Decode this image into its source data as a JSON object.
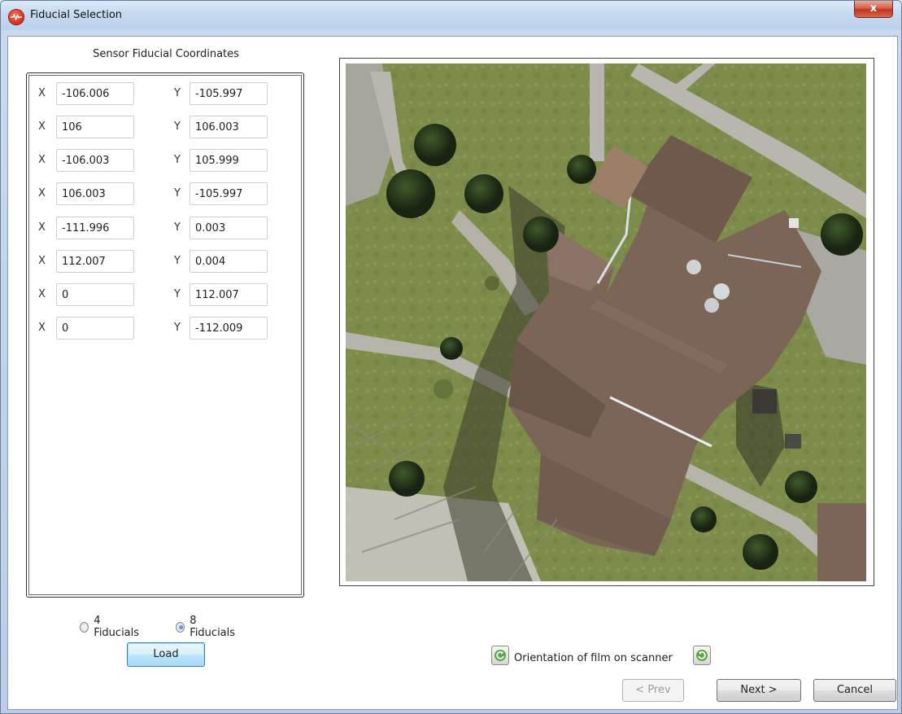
{
  "window": {
    "title": "Fiducial Selection",
    "close_glyph": "x"
  },
  "coordinates": {
    "title": "Sensor Fiducial Coordinates",
    "x_label": "X",
    "y_label": "Y",
    "rows": [
      {
        "x": "-106.006",
        "y": "-105.997"
      },
      {
        "x": "106",
        "y": "106.003"
      },
      {
        "x": "-106.003",
        "y": "105.999"
      },
      {
        "x": "106.003",
        "y": "-105.997"
      },
      {
        "x": "-111.996",
        "y": "0.003"
      },
      {
        "x": "112.007",
        "y": "0.004"
      },
      {
        "x": "0",
        "y": "112.007"
      },
      {
        "x": "0",
        "y": "-112.009"
      }
    ]
  },
  "fiducial_options": {
    "option_4": "4 Fiducials",
    "option_8": "8 Fiducials",
    "selected": "8 Fiducials"
  },
  "buttons": {
    "load": "Load",
    "prev": "< Prev",
    "next": "Next >",
    "cancel": "Cancel"
  },
  "orientation": {
    "label": "Orientation of film on scanner",
    "rotate_left_icon": "rotate-counterclockwise-icon",
    "rotate_right_icon": "rotate-clockwise-icon"
  },
  "colors": {
    "title_bar": "#c6d8ef",
    "close_button": "#c2321b",
    "roof": "#7b6557",
    "grass": "#7f8d4c",
    "button_focus": "#3c7fb1"
  }
}
